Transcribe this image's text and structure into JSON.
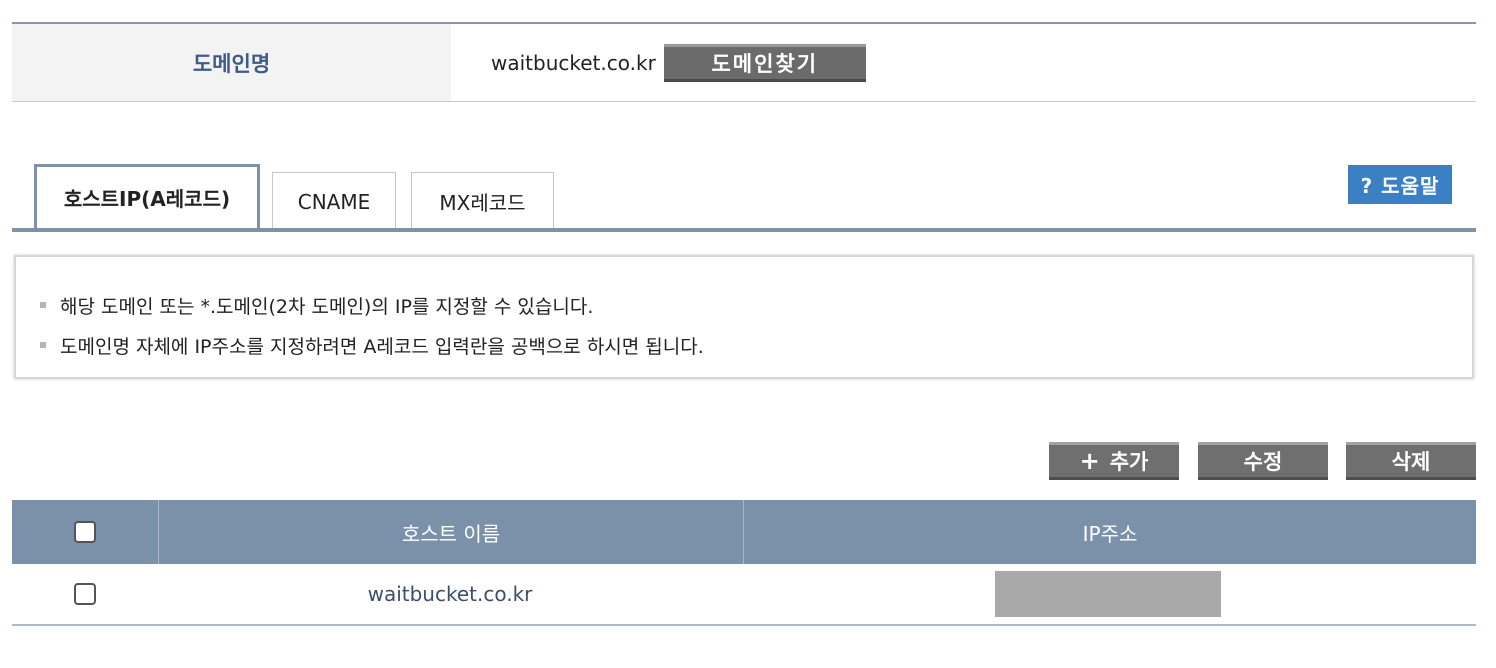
{
  "domain": {
    "label": "도메인명",
    "value": "waitbucket.co.kr",
    "find_button": "도메인찾기"
  },
  "tabs": [
    {
      "label": "호스트IP(A레코드)",
      "active": true
    },
    {
      "label": "CNAME",
      "active": false
    },
    {
      "label": "MX레코드",
      "active": false
    }
  ],
  "help_button": "? 도움말",
  "info": {
    "lines": [
      "해당 도메인 또는 *.도메인(2차 도메인)의 IP를 지정할 수 있습니다.",
      "도메인명 자체에 IP주소를 지정하려면 A레코드 입력란을 공백으로 하시면 됩니다."
    ]
  },
  "actions": {
    "add_icon": "+",
    "add": "추가",
    "edit": "수정",
    "delete": "삭제"
  },
  "table": {
    "headers": [
      "호스트 이름",
      "IP주소"
    ],
    "rows": [
      {
        "host": "waitbucket.co.kr",
        "checked": false
      }
    ]
  },
  "colors": {
    "header_bg": "#7b91aa",
    "help_bg": "#3b7fc4",
    "button_bg": "#6f6f6f"
  }
}
